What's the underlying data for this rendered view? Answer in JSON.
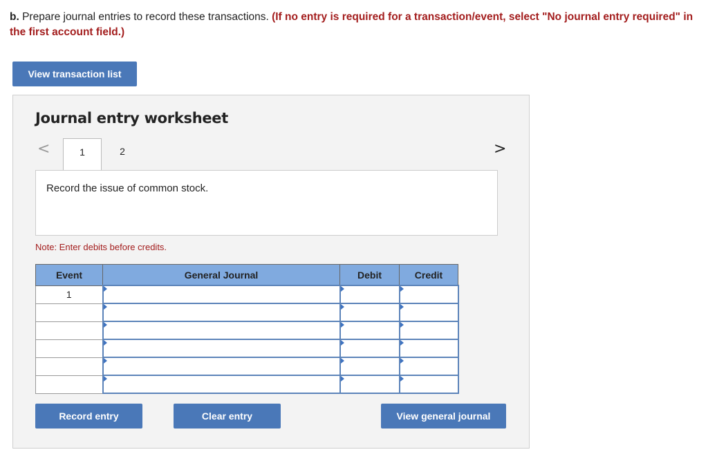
{
  "instructions": {
    "prefix": "b.",
    "text": " Prepare journal entries to record these transactions. ",
    "emphasis": "(If no entry is required for a transaction/event, select \"No journal entry required\" in the first account field.)"
  },
  "view_transaction_list": "View transaction list",
  "worksheet": {
    "title": "Journal entry worksheet",
    "prev": "<",
    "next": ">",
    "tabs": [
      "1",
      "2"
    ],
    "description": "Record the issue of common stock.",
    "note": "Note: Enter debits before credits.",
    "columns": [
      "Event",
      "General Journal",
      "Debit",
      "Credit"
    ],
    "rows": [
      {
        "event": "1"
      },
      {
        "event": ""
      },
      {
        "event": ""
      },
      {
        "event": ""
      },
      {
        "event": ""
      },
      {
        "event": ""
      }
    ]
  },
  "buttons": {
    "record": "Record entry",
    "clear": "Clear entry",
    "view_general": "View general journal"
  },
  "colors": {
    "accent": "#4a78b8",
    "header": "#80aadf",
    "emphasis": "#a31d1d"
  }
}
